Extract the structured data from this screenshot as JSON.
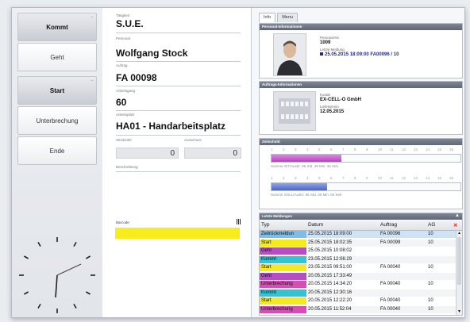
{
  "left": {
    "buttons": [
      {
        "label": "Kommt",
        "active": true
      },
      {
        "label": "Geht",
        "active": false
      },
      {
        "label": "Start",
        "active": true
      },
      {
        "label": "Unterbrechung",
        "active": false
      },
      {
        "label": "Ende",
        "active": false
      }
    ]
  },
  "middle": {
    "taetigkeit_label": "Tätigkeit",
    "taetigkeit_value": "S.U.E.",
    "personal_label": "Personal",
    "personal_value": "Wolfgang Stock",
    "auftrag_label": "Auftrag",
    "auftrag_value": "FA 00098",
    "arbeitsgang_label": "Arbeitsgang",
    "arbeitsgang_value": "60",
    "arbeitsplatz_label": "Arbeitsplatz",
    "arbeitsplatz_value": "HA01 - Handarbeitsplatz",
    "stueckzahl_label": "Stückzahl",
    "stueckzahl_value": "0",
    "ausschuss_label": "Ausschuss",
    "ausschuss_value": "0",
    "beschreibung_label": "Beschreibung",
    "barcode_label": "Barcode"
  },
  "right": {
    "tabs": [
      "Info",
      "Menu"
    ],
    "personal": {
      "header": "Personal-Informationen",
      "nr_label": "Personal-Nr.",
      "nr_value": "1009",
      "meldung_label": "Letzte Meldung",
      "meldung_value": "25.05.2015 18:09:00 FA00096 / 10"
    },
    "auftrag": {
      "header": "Auftrags-Informationen",
      "kunde_label": "Kunde",
      "kunde_value": "EX-CELL-O GmbH",
      "liefertermin_label": "Liefertermin",
      "liefertermin_value": "12.05.2015"
    },
    "zeitschnitt": {
      "header": "Zeitschnitt",
      "ticks": [
        "1",
        "2",
        "3",
        "4",
        "5",
        "6",
        "7",
        "8",
        "9",
        "10",
        "11",
        "12",
        "13",
        "14",
        "15",
        "16"
      ],
      "summe_ist": "Summe IST/Ausbr: 86 Std. 49 Min. 33 Sek.",
      "summe_soll": "Summe SOLL/Ausbr: 86 Std. 30 Min. 60 Sek."
    },
    "meldungen": {
      "header": "Letzte Meldungen",
      "columns": [
        "Typ",
        "Datum",
        "Auftrag",
        "AG"
      ],
      "rows": [
        {
          "typ": "Zeitrückmeldun",
          "datum": "25.05.2015 18:09:00",
          "auftrag": "FA 00096",
          "ag": "10",
          "color": "#7fbde8"
        },
        {
          "typ": "Start",
          "datum": "25.05.2015 18:02:35",
          "auftrag": "FA 00099",
          "ag": "10",
          "color": "#f3ea20"
        },
        {
          "typ": "Geht",
          "datum": "25.05.2015 10:08:02",
          "auftrag": "",
          "ag": "",
          "color": "#b44fc3"
        },
        {
          "typ": "Kommt",
          "datum": "23.05.2015 12:06:29",
          "auftrag": "",
          "ag": "",
          "color": "#30c4d4"
        },
        {
          "typ": "Start",
          "datum": "23.05.2015 09:51:00",
          "auftrag": "FA 00040",
          "ag": "10",
          "color": "#f3ea20"
        },
        {
          "typ": "Geht",
          "datum": "20.05.2015 17:33:49",
          "auftrag": "",
          "ag": "",
          "color": "#b44fc3"
        },
        {
          "typ": "Unterbrechung",
          "datum": "20.05.2015 14:34:20",
          "auftrag": "FA 00040",
          "ag": "10",
          "color": "#d44fb3"
        },
        {
          "typ": "Kommt",
          "datum": "20.05.2015 12:30:16",
          "auftrag": "",
          "ag": "",
          "color": "#30c4d4"
        },
        {
          "typ": "Start",
          "datum": "20.05.2015 12:22:20",
          "auftrag": "FA 00040",
          "ag": "10",
          "color": "#f3ea20"
        },
        {
          "typ": "Unterbrechung",
          "datum": "20.05.2015 11:52:04",
          "auftrag": "FA 00040",
          "ag": "10",
          "color": "#d44fb3"
        }
      ]
    }
  }
}
